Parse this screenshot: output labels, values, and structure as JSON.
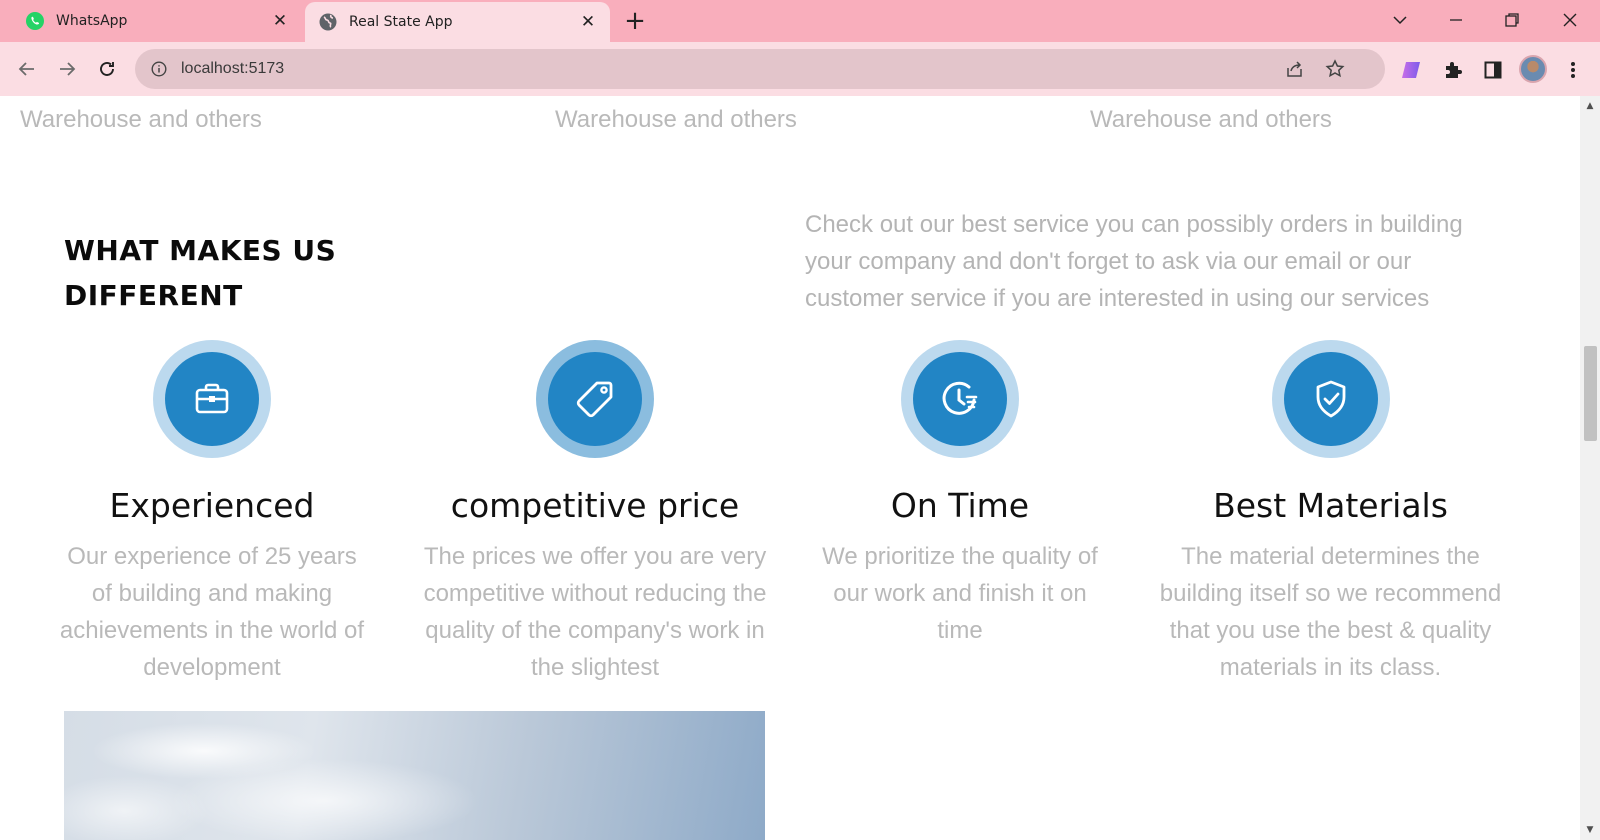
{
  "browser": {
    "tabs": [
      {
        "title": "WhatsApp",
        "icon": "whatsapp-icon",
        "active": false
      },
      {
        "title": "Real State App",
        "icon": "globe-icon",
        "active": true
      }
    ],
    "close_glyph": "✕",
    "new_tab_glyph": "+",
    "address": "localhost:5173",
    "colors": {
      "tabstrip": "#f9aebc",
      "toolbar": "#fbdde3",
      "omnibox": "#e3c5cb"
    }
  },
  "page": {
    "previous_section": {
      "lines": [
        "Warehouse and others",
        "Warehouse and others",
        "Warehouse and others"
      ]
    },
    "different": {
      "title": "WHAT MAKES US DIFFERENT",
      "intro": "Check out our best service you can possibly orders in building your company and don't forget to ask via our email or our customer service if you are interested in using our services"
    },
    "features": [
      {
        "icon": "briefcase-icon",
        "title": "Experienced",
        "description": "Our experience of 25 years of building and making achievements in the world of development"
      },
      {
        "icon": "price-tag-icon",
        "title": "competitive price",
        "description": "The prices we offer you are very competitive without reducing the quality of the company's work in the slightest"
      },
      {
        "icon": "clock-icon",
        "title": "On Time",
        "description": "We prioritize the quality of our work and finish it on time"
      },
      {
        "icon": "shield-check-icon",
        "title": "Best Materials",
        "description": "The material determines the building itself so we recommend that you use the best & quality materials in its class."
      }
    ],
    "colors": {
      "accent": "#2285c5",
      "ring": "#bcd9ee",
      "ring_dark": "#8bbddf",
      "muted_text": "#b9b9b9"
    }
  }
}
